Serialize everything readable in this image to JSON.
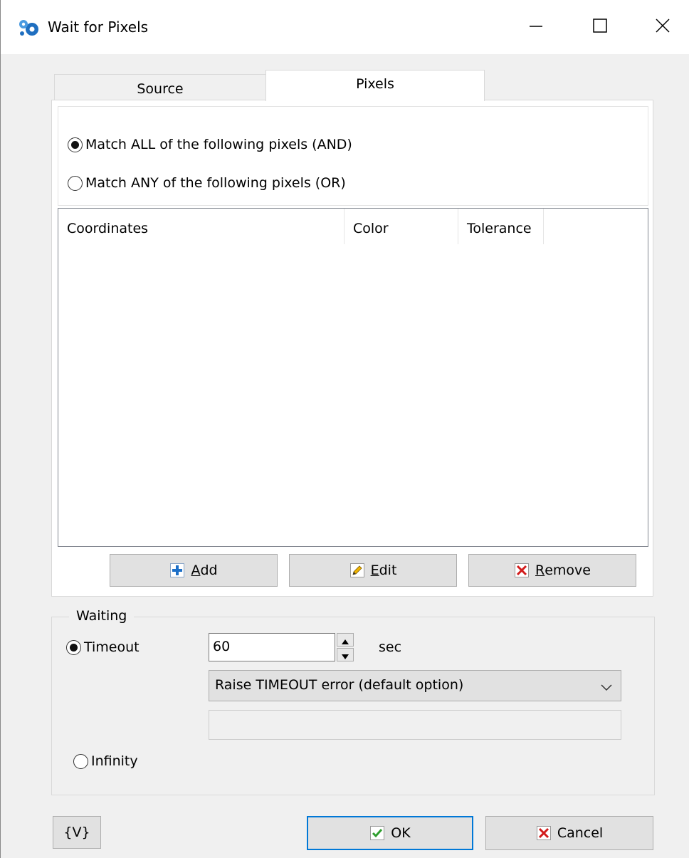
{
  "window": {
    "title": "Wait for Pixels",
    "icon": "app-gears-icon",
    "controls": [
      "minimize-icon",
      "maximize-icon",
      "close-icon"
    ]
  },
  "tabs": [
    {
      "label": "Source",
      "active": false
    },
    {
      "label": "Pixels",
      "active": true
    }
  ],
  "match_mode": {
    "options": [
      {
        "label": "Match ALL of the following pixels (AND)",
        "selected": true
      },
      {
        "label": "Match ANY of the following pixels (OR)",
        "selected": false
      }
    ]
  },
  "pixel_list": {
    "columns": [
      "Coordinates",
      "Color",
      "Tolerance"
    ],
    "rows": []
  },
  "list_buttons": {
    "add": {
      "label": "Add",
      "accel": "A",
      "icon": "plus-icon"
    },
    "edit": {
      "label": "Edit",
      "accel": "E",
      "icon": "pencil-icon"
    },
    "remove": {
      "label": "Remove",
      "accel": "R",
      "icon": "red-x-icon"
    }
  },
  "waiting": {
    "title": "Waiting",
    "timeout_option": {
      "label": "Timeout",
      "selected": true
    },
    "timeout_value": "60",
    "unit": "sec",
    "on_timeout": "Raise TIMEOUT error (default option)",
    "infinity_option": {
      "label": "Infinity",
      "selected": false
    }
  },
  "footer": {
    "vars_label": "{V}",
    "ok_label": "OK",
    "cancel_label": "Cancel"
  },
  "colors": {
    "accent": "#0078d7",
    "plus_icon": "#1c6fc8",
    "remove_icon": "#d21c1c",
    "ok_check": "#2e9e2e"
  }
}
